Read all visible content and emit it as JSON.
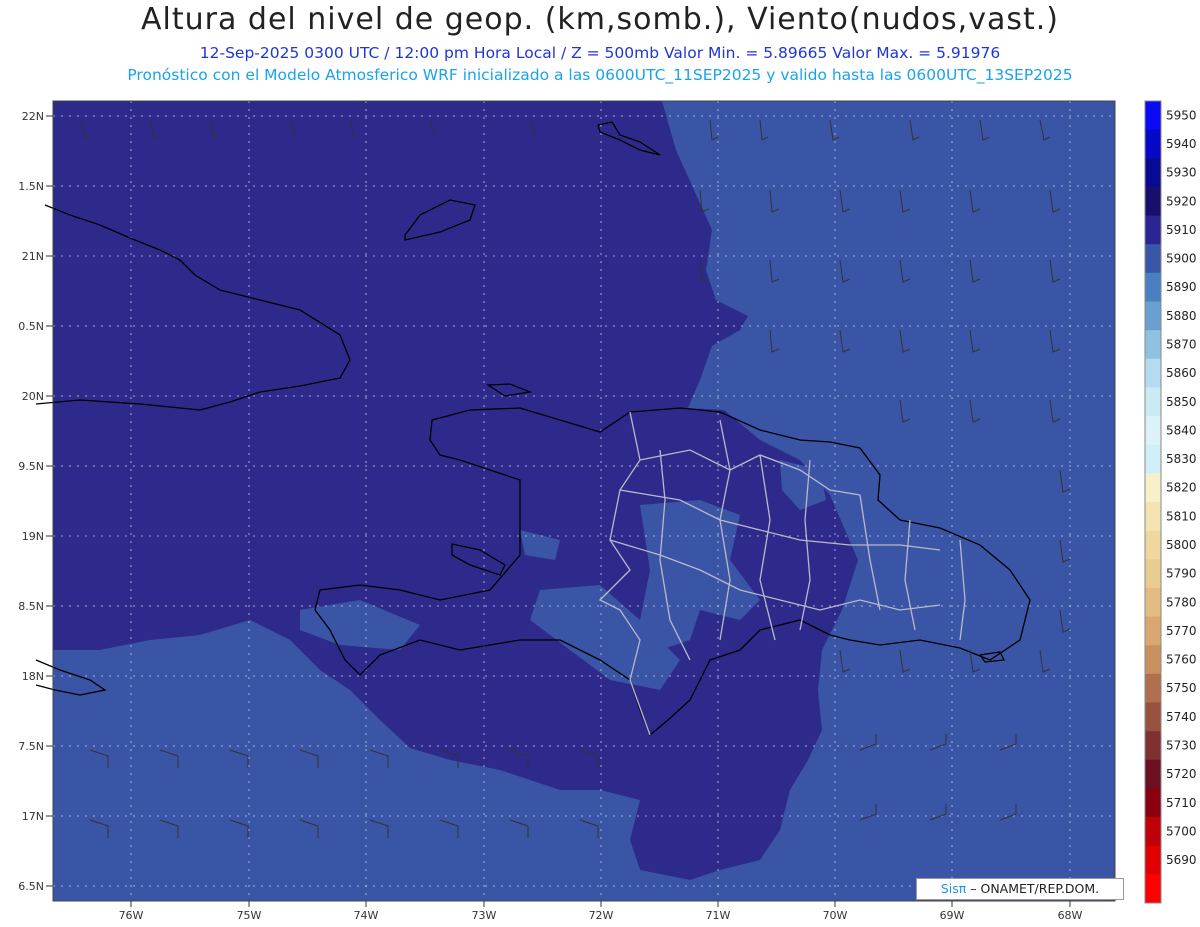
{
  "header": {
    "title": "Altura del nivel de geop. (km,somb.), Viento(nudos,vast.)",
    "subtitle": "12-Sep-2025  0300 UTC / 12:00 pm Hora Local / Z = 500mb     Valor Min. = 5.89665  Valor Max. = 5.91976",
    "model_line": "Pronóstico con el Modelo Atmosferico WRF inicializado a las 0600UTC_11SEP2025 y valido hasta las  0600UTC_13SEP2025"
  },
  "axes": {
    "lat_labels": [
      "22N",
      "1.5N",
      "21N",
      "0.5N",
      "20N",
      "9.5N",
      "19N",
      "8.5N",
      "18N",
      "7.5N",
      "17N",
      "6.5N"
    ],
    "lon_labels": [
      "76W",
      "75W",
      "74W",
      "73W",
      "72W",
      "71W",
      "70W",
      "69W",
      "68W"
    ]
  },
  "colorbar": {
    "levels": [
      "5950",
      "5940",
      "5930",
      "5920",
      "5910",
      "5900",
      "5890",
      "5880",
      "5870",
      "5860",
      "5850",
      "5840",
      "5830",
      "5820",
      "5810",
      "5800",
      "5790",
      "5780",
      "5770",
      "5760",
      "5750",
      "5740",
      "5730",
      "5720",
      "5710",
      "5700",
      "5690"
    ],
    "colors": [
      "#0a0af5",
      "#0707c8",
      "#090a94",
      "#160f6e",
      "#2a2490",
      "#3a56a8",
      "#4a7fc0",
      "#6aa0d0",
      "#8ec2e0",
      "#b4dcee",
      "#cceaf4",
      "#dcf2f8",
      "#cfeef8",
      "#f8f0c8",
      "#f3e4b4",
      "#eed8a0",
      "#e8cc90",
      "#e2bc80",
      "#d8a870",
      "#c89060",
      "#b07050",
      "#985040",
      "#803030",
      "#6a1020",
      "#8a0010",
      "#c00008",
      "#e00000",
      "#ff0000"
    ]
  },
  "map_colors": {
    "deep": "#2e2a8c",
    "medium": "#3a55a6",
    "light": "#4a6fbc"
  },
  "credit": {
    "brand": "Sisπ",
    "text": " – ONAMET/REP.DOM."
  }
}
